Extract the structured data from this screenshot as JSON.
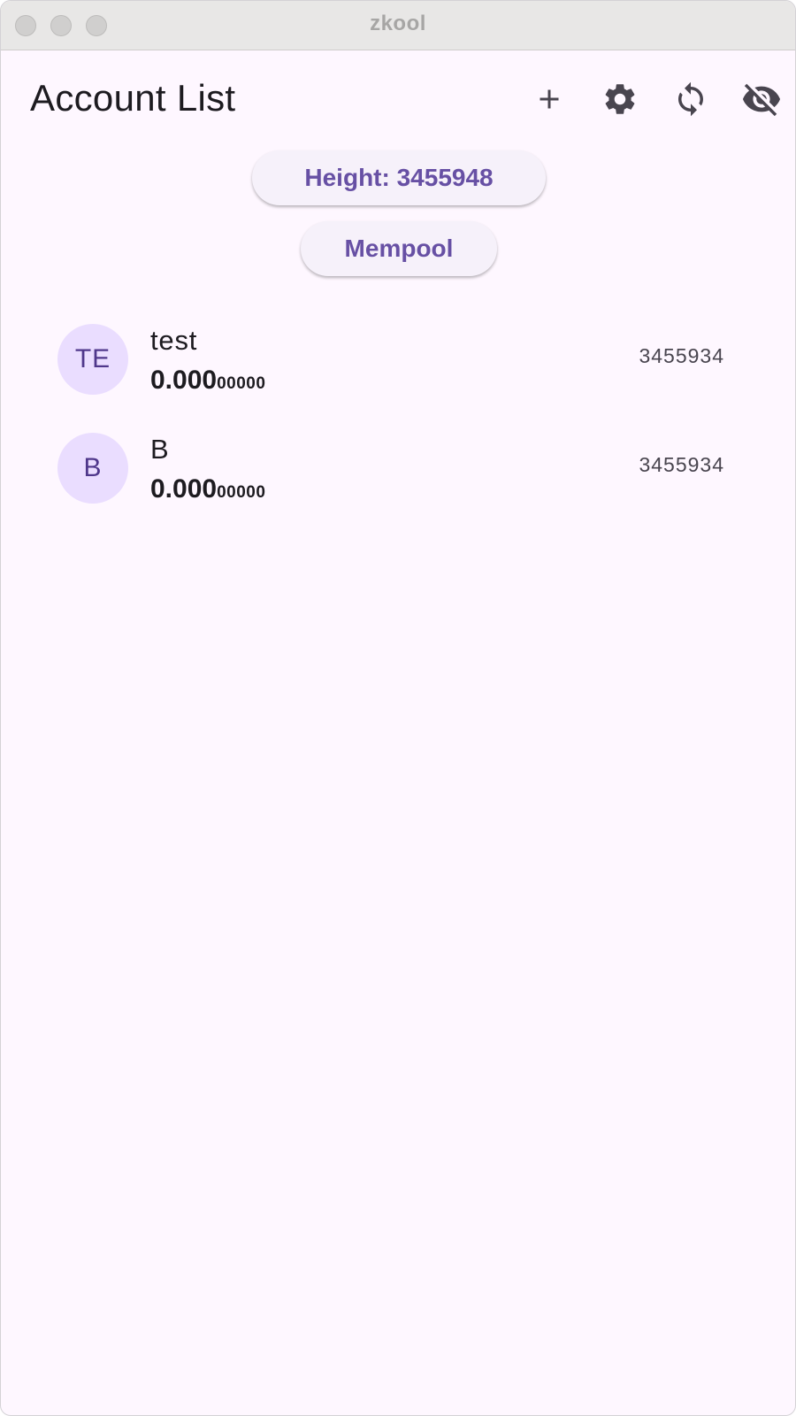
{
  "window": {
    "title": "zkool"
  },
  "appbar": {
    "title": "Account List",
    "actions": [
      {
        "icon": "add-icon"
      },
      {
        "icon": "gear-icon"
      },
      {
        "icon": "sync-icon"
      },
      {
        "icon": "eye-off-icon"
      }
    ]
  },
  "status": {
    "height_label": "Height: 3455948",
    "mempool_label": "Mempool"
  },
  "accounts": [
    {
      "initials": "TE",
      "name": "test",
      "balance_main": "0.000",
      "balance_fraction": "00000",
      "height": "3455934"
    },
    {
      "initials": "B",
      "name": "B",
      "balance_main": "0.000",
      "balance_fraction": "00000",
      "height": "3455934"
    }
  ],
  "colors": {
    "background": "#fef7ff",
    "accent": "#6750a4",
    "avatar_bg": "#eaddff",
    "avatar_text": "#4f378b",
    "icon": "#49454f"
  }
}
